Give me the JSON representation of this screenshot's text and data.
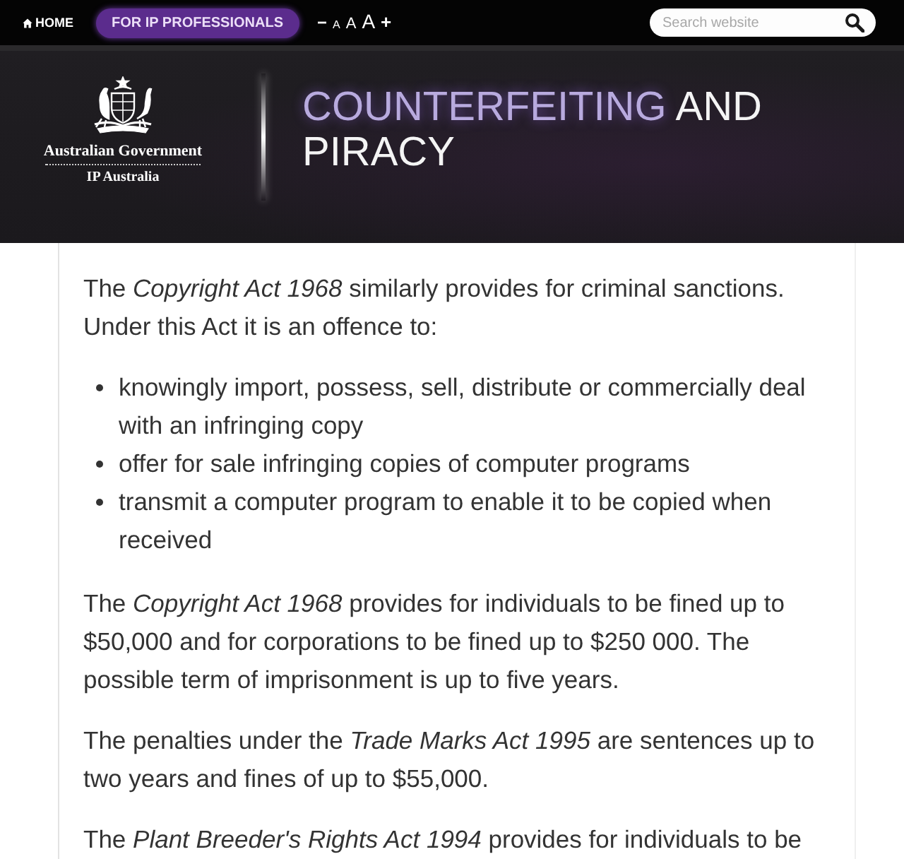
{
  "top_bar": {
    "home": {
      "label": "HOME"
    },
    "audience_button": {
      "label": "FOR IP PROFESSIONALS"
    },
    "text_size": {
      "decrease": "−",
      "sizes": [
        "A",
        "A",
        "A"
      ],
      "increase": "+"
    },
    "search": {
      "placeholder": "Search website"
    }
  },
  "header": {
    "logo": {
      "line_1": "Australian Government",
      "line_2": "IP Australia"
    },
    "title": {
      "highlight": "COUNTERFEITING",
      "rest": "AND PIRACY"
    }
  },
  "content": [
    {
      "kind": "paragraph",
      "text": "The *Copyright Act 1968* similarly provides for criminal sanctions. Under this Act it is an offence to:"
    },
    {
      "kind": "bullets",
      "items": [
        "knowingly import, possess, sell, distribute or commercially deal with an infringing copy",
        "offer for sale infringing copies of computer programs",
        "transmit a computer program to enable it to be copied when received"
      ]
    },
    {
      "kind": "paragraph",
      "text": "The *Copyright Act 1968* provides for individuals to be fined up to $50,000 and for corporations to be fined up to $250 000. The possible term of imprisonment is up to five years."
    },
    {
      "kind": "paragraph",
      "text": "The penalties under the *Trade Marks Act 1995* are sentences up to two years and fines of up to $55,000."
    },
    {
      "kind": "paragraph",
      "text": "The *Plant Breeder's Rights Act 1994* provides for individuals to be"
    }
  ]
}
